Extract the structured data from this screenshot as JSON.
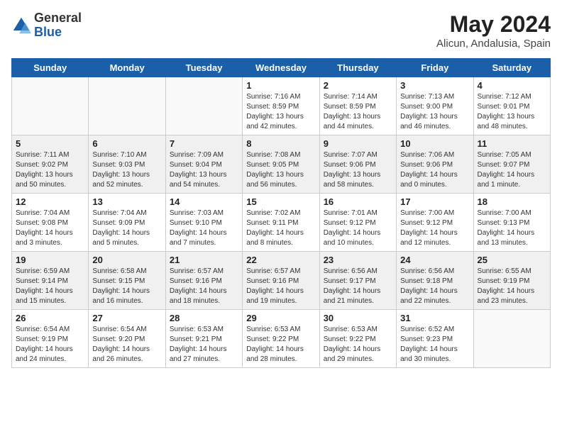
{
  "header": {
    "logo_general": "General",
    "logo_blue": "Blue",
    "month_year": "May 2024",
    "location": "Alicun, Andalusia, Spain"
  },
  "weekdays": [
    "Sunday",
    "Monday",
    "Tuesday",
    "Wednesday",
    "Thursday",
    "Friday",
    "Saturday"
  ],
  "weeks": [
    [
      {
        "day": "",
        "info": ""
      },
      {
        "day": "",
        "info": ""
      },
      {
        "day": "",
        "info": ""
      },
      {
        "day": "1",
        "info": "Sunrise: 7:16 AM\nSunset: 8:59 PM\nDaylight: 13 hours\nand 42 minutes."
      },
      {
        "day": "2",
        "info": "Sunrise: 7:14 AM\nSunset: 8:59 PM\nDaylight: 13 hours\nand 44 minutes."
      },
      {
        "day": "3",
        "info": "Sunrise: 7:13 AM\nSunset: 9:00 PM\nDaylight: 13 hours\nand 46 minutes."
      },
      {
        "day": "4",
        "info": "Sunrise: 7:12 AM\nSunset: 9:01 PM\nDaylight: 13 hours\nand 48 minutes."
      }
    ],
    [
      {
        "day": "5",
        "info": "Sunrise: 7:11 AM\nSunset: 9:02 PM\nDaylight: 13 hours\nand 50 minutes."
      },
      {
        "day": "6",
        "info": "Sunrise: 7:10 AM\nSunset: 9:03 PM\nDaylight: 13 hours\nand 52 minutes."
      },
      {
        "day": "7",
        "info": "Sunrise: 7:09 AM\nSunset: 9:04 PM\nDaylight: 13 hours\nand 54 minutes."
      },
      {
        "day": "8",
        "info": "Sunrise: 7:08 AM\nSunset: 9:05 PM\nDaylight: 13 hours\nand 56 minutes."
      },
      {
        "day": "9",
        "info": "Sunrise: 7:07 AM\nSunset: 9:06 PM\nDaylight: 13 hours\nand 58 minutes."
      },
      {
        "day": "10",
        "info": "Sunrise: 7:06 AM\nSunset: 9:06 PM\nDaylight: 14 hours\nand 0 minutes."
      },
      {
        "day": "11",
        "info": "Sunrise: 7:05 AM\nSunset: 9:07 PM\nDaylight: 14 hours\nand 1 minute."
      }
    ],
    [
      {
        "day": "12",
        "info": "Sunrise: 7:04 AM\nSunset: 9:08 PM\nDaylight: 14 hours\nand 3 minutes."
      },
      {
        "day": "13",
        "info": "Sunrise: 7:04 AM\nSunset: 9:09 PM\nDaylight: 14 hours\nand 5 minutes."
      },
      {
        "day": "14",
        "info": "Sunrise: 7:03 AM\nSunset: 9:10 PM\nDaylight: 14 hours\nand 7 minutes."
      },
      {
        "day": "15",
        "info": "Sunrise: 7:02 AM\nSunset: 9:11 PM\nDaylight: 14 hours\nand 8 minutes."
      },
      {
        "day": "16",
        "info": "Sunrise: 7:01 AM\nSunset: 9:12 PM\nDaylight: 14 hours\nand 10 minutes."
      },
      {
        "day": "17",
        "info": "Sunrise: 7:00 AM\nSunset: 9:12 PM\nDaylight: 14 hours\nand 12 minutes."
      },
      {
        "day": "18",
        "info": "Sunrise: 7:00 AM\nSunset: 9:13 PM\nDaylight: 14 hours\nand 13 minutes."
      }
    ],
    [
      {
        "day": "19",
        "info": "Sunrise: 6:59 AM\nSunset: 9:14 PM\nDaylight: 14 hours\nand 15 minutes."
      },
      {
        "day": "20",
        "info": "Sunrise: 6:58 AM\nSunset: 9:15 PM\nDaylight: 14 hours\nand 16 minutes."
      },
      {
        "day": "21",
        "info": "Sunrise: 6:57 AM\nSunset: 9:16 PM\nDaylight: 14 hours\nand 18 minutes."
      },
      {
        "day": "22",
        "info": "Sunrise: 6:57 AM\nSunset: 9:16 PM\nDaylight: 14 hours\nand 19 minutes."
      },
      {
        "day": "23",
        "info": "Sunrise: 6:56 AM\nSunset: 9:17 PM\nDaylight: 14 hours\nand 21 minutes."
      },
      {
        "day": "24",
        "info": "Sunrise: 6:56 AM\nSunset: 9:18 PM\nDaylight: 14 hours\nand 22 minutes."
      },
      {
        "day": "25",
        "info": "Sunrise: 6:55 AM\nSunset: 9:19 PM\nDaylight: 14 hours\nand 23 minutes."
      }
    ],
    [
      {
        "day": "26",
        "info": "Sunrise: 6:54 AM\nSunset: 9:19 PM\nDaylight: 14 hours\nand 24 minutes."
      },
      {
        "day": "27",
        "info": "Sunrise: 6:54 AM\nSunset: 9:20 PM\nDaylight: 14 hours\nand 26 minutes."
      },
      {
        "day": "28",
        "info": "Sunrise: 6:53 AM\nSunset: 9:21 PM\nDaylight: 14 hours\nand 27 minutes."
      },
      {
        "day": "29",
        "info": "Sunrise: 6:53 AM\nSunset: 9:22 PM\nDaylight: 14 hours\nand 28 minutes."
      },
      {
        "day": "30",
        "info": "Sunrise: 6:53 AM\nSunset: 9:22 PM\nDaylight: 14 hours\nand 29 minutes."
      },
      {
        "day": "31",
        "info": "Sunrise: 6:52 AM\nSunset: 9:23 PM\nDaylight: 14 hours\nand 30 minutes."
      },
      {
        "day": "",
        "info": ""
      }
    ]
  ]
}
